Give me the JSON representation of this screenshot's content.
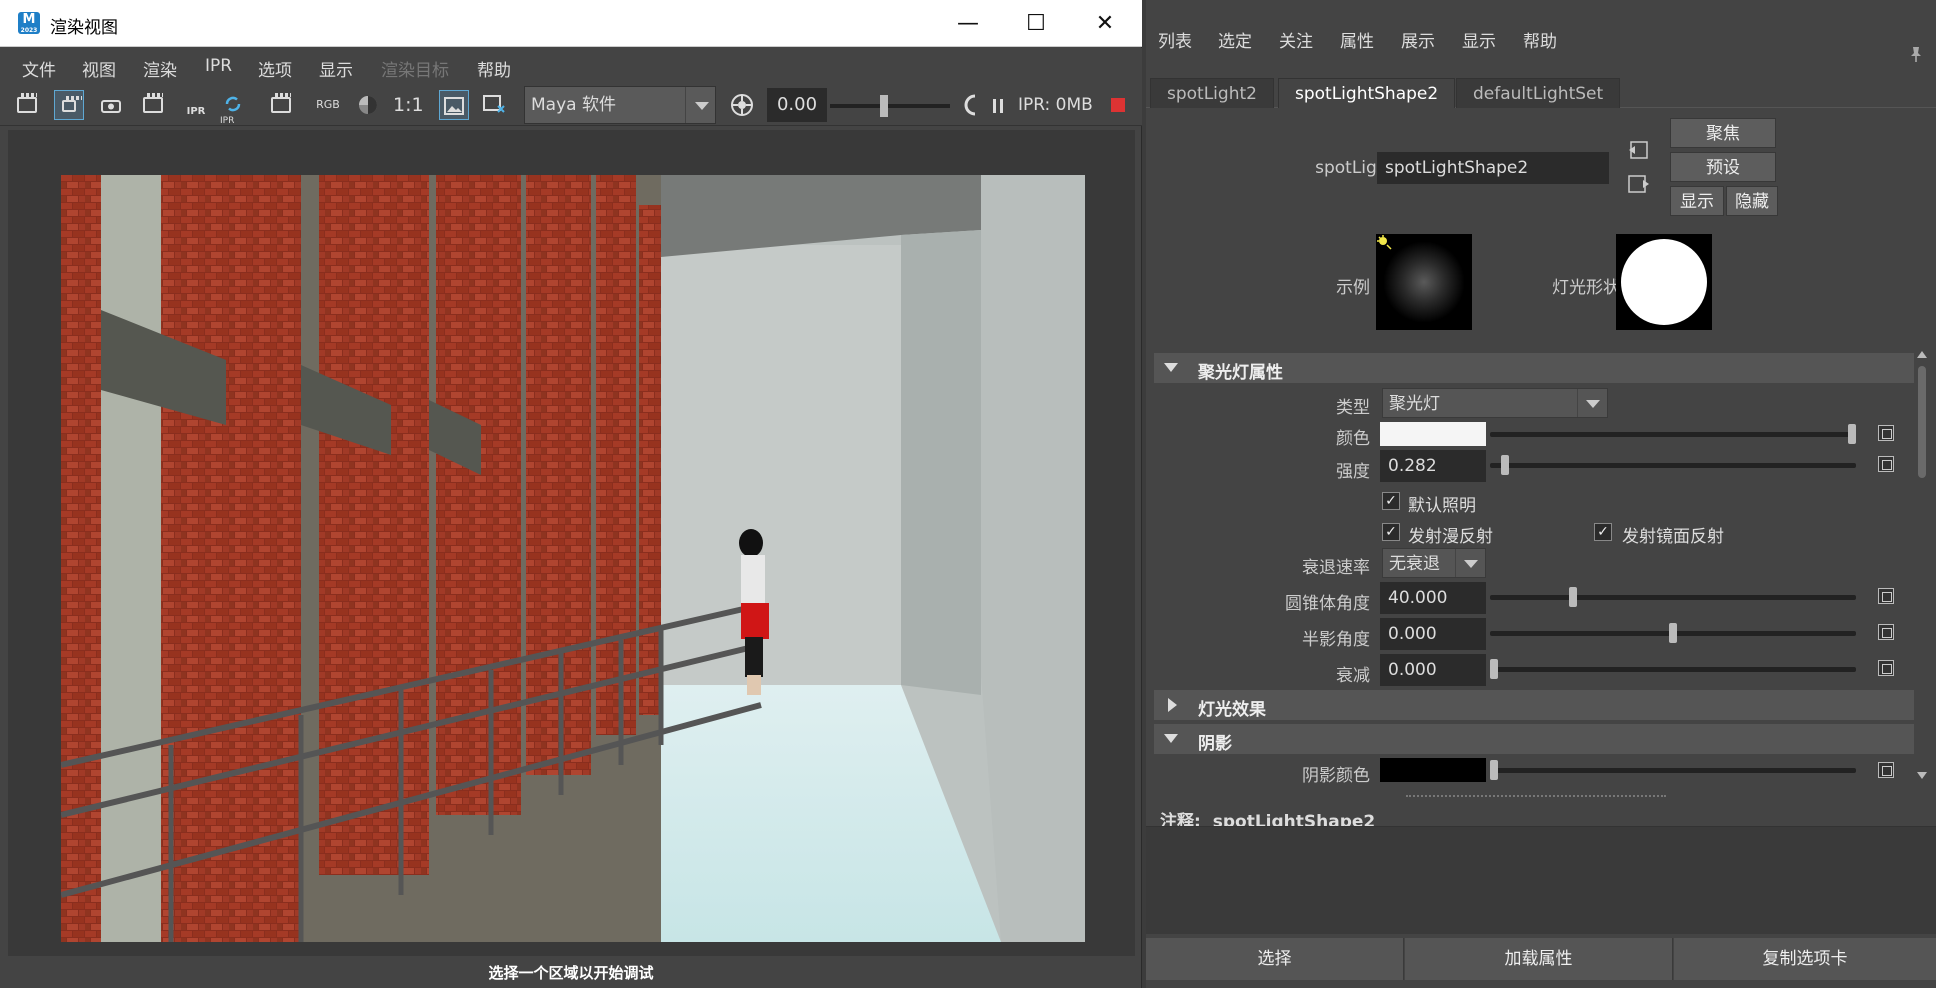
{
  "render_view": {
    "title": "渲染视图",
    "app_icon_letter": "M",
    "app_icon_sub": "2023",
    "menu": [
      "文件",
      "视图",
      "渲染",
      "IPR",
      "选项",
      "显示",
      "渲染目标",
      "帮助"
    ],
    "toolbar": {
      "rgb_label": "RGB",
      "one_to_one": "1:1",
      "renderer": "Maya 软件",
      "exposure": "0.00",
      "exposure_slider": 0.45,
      "ipr_memory": "IPR: 0MB",
      "ipr_label_a": "IPR",
      "ipr_label_b": "IPR"
    },
    "status": "选择一个区域以开始调试"
  },
  "attr_editor": {
    "menu": [
      "列表",
      "选定",
      "关注",
      "属性",
      "展示",
      "显示",
      "帮助"
    ],
    "tabs": [
      "spotLight2",
      "spotLightShape2",
      "defaultLightSet"
    ],
    "active_tab": 1,
    "node_label": "spotLight:",
    "node_name": "spotLightShape2",
    "buttons": {
      "focus": "聚焦",
      "presets": "预设",
      "show": "显示",
      "hide": "隐藏"
    },
    "sample_label": "示例",
    "light_shape_label": "灯光形状",
    "sections": {
      "spot_attrs": "聚光灯属性",
      "light_effects": "灯光效果",
      "shadows": "阴影"
    },
    "attrs": {
      "type_label": "类型",
      "type_value": "聚光灯",
      "color_label": "颜色",
      "color_value": "#f5f5f5",
      "color_slider": 1.0,
      "intensity_label": "强度",
      "intensity_value": "0.282",
      "intensity_slider": 0.03,
      "default_light_label": "默认照明",
      "emit_diffuse_label": "发射漫反射",
      "emit_specular_label": "发射镜面反射",
      "decay_label": "衰退速率",
      "decay_value": "无衰退",
      "cone_label": "圆锥体角度",
      "cone_value": "40.000",
      "cone_slider": 0.22,
      "penumbra_label": "半影角度",
      "penumbra_value": "0.000",
      "penumbra_slider": 0.5,
      "dropoff_label": "衰减",
      "dropoff_value": "0.000",
      "dropoff_slider": 0.0,
      "shadow_color_label": "阴影颜色",
      "shadow_color_value": "#000000",
      "shadow_slider": 0.0
    },
    "notes_label": "注释:",
    "notes_node": "spotLightShape2",
    "bottom_buttons": [
      "选择",
      "加载属性",
      "复制选项卡"
    ]
  }
}
